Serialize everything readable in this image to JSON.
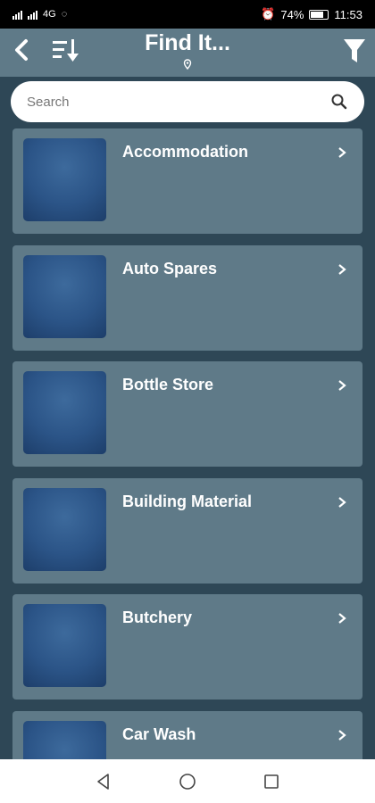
{
  "status_bar": {
    "network_label": "4G",
    "battery_percent": "74%",
    "time": "11:53"
  },
  "header": {
    "title": "Find It...",
    "icons": [
      "back-icon",
      "sort-icon",
      "filter-icon",
      "location-pin-icon"
    ]
  },
  "search": {
    "placeholder": "Search",
    "value": ""
  },
  "categories": [
    {
      "label": "Accommodation"
    },
    {
      "label": "Auto Spares"
    },
    {
      "label": "Bottle Store"
    },
    {
      "label": "Building Material"
    },
    {
      "label": "Butchery"
    },
    {
      "label": "Car Wash"
    }
  ],
  "colors": {
    "background": "#2e4756",
    "card": "#5f7a88",
    "thumbnail": "#2b5487"
  },
  "nav": {
    "icons": [
      "back-triangle-icon",
      "home-circle-icon",
      "recents-square-icon"
    ]
  }
}
